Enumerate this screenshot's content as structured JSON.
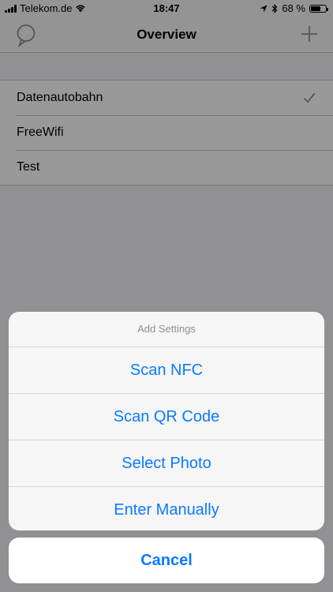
{
  "status_bar": {
    "carrier": "Telekom.de",
    "time": "18:47",
    "battery_text": "68 %",
    "battery_level": 0.68
  },
  "nav": {
    "title": "Overview",
    "left_icon": "bubble-icon",
    "right_icon": "plus-icon"
  },
  "networks": [
    {
      "label": "Datenautobahn",
      "selected": true
    },
    {
      "label": "FreeWifi",
      "selected": false
    },
    {
      "label": "Test",
      "selected": false
    }
  ],
  "action_sheet": {
    "title": "Add Settings",
    "actions": [
      "Scan NFC",
      "Scan QR Code",
      "Select Photo",
      "Enter Manually"
    ],
    "cancel": "Cancel"
  },
  "colors": {
    "accent": "#0a7aff",
    "overlay": "rgba(0,0,0,0.40)"
  }
}
